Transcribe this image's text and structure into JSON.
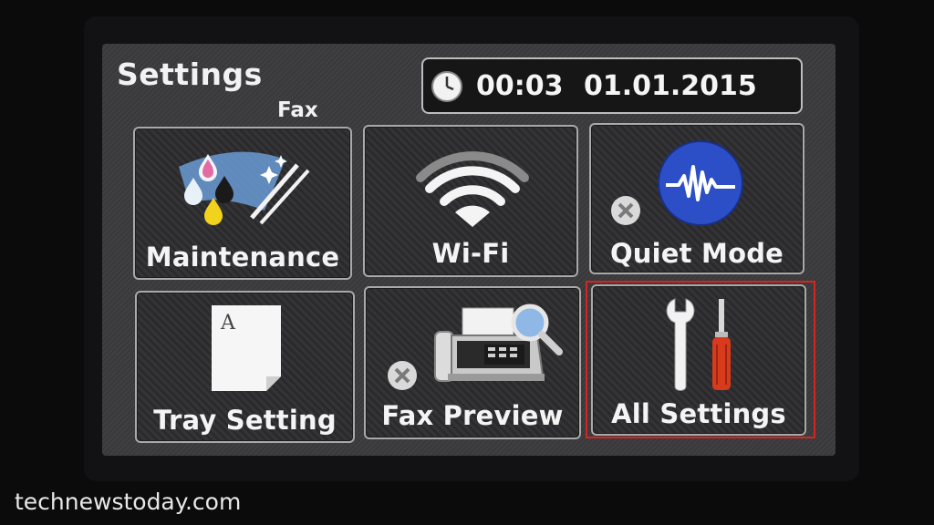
{
  "header": {
    "title": "Settings",
    "sublabel": "Fax",
    "time": "00:03",
    "date": "01.01.2015"
  },
  "tiles": [
    {
      "label": "Maintenance",
      "icon": "ink-drops-wiper-icon",
      "enabled": true
    },
    {
      "label": "Wi-Fi",
      "icon": "wifi-icon",
      "enabled": true
    },
    {
      "label": "Quiet Mode",
      "icon": "sound-wave-icon",
      "enabled": false
    },
    {
      "label": "Tray Setting",
      "icon": "paper-tray-icon",
      "enabled": true
    },
    {
      "label": "Fax Preview",
      "icon": "fax-magnifier-icon",
      "enabled": false
    },
    {
      "label": "All Settings",
      "icon": "wrench-screwdriver-icon",
      "enabled": true,
      "highlighted": true
    }
  ],
  "colors": {
    "highlight": "#d9231f",
    "quiet_mode_badge": "#2c4fc7",
    "screwdriver_handle": "#d83a1e"
  },
  "watermark": "technewstoday.com"
}
